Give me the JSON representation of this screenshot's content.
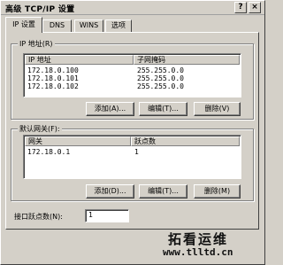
{
  "window": {
    "title": "高级 TCP/IP 设置",
    "help_button": "?",
    "close_button": "×"
  },
  "tabs": [
    {
      "label": "IP 设置"
    },
    {
      "label": "DNS"
    },
    {
      "label": "WINS"
    },
    {
      "label": "选项"
    }
  ],
  "ip_group": {
    "label": "IP 地址(R)",
    "columns": [
      "IP 地址",
      "子网掩码"
    ],
    "rows": [
      [
        "172.18.0.100",
        "255.255.0.0"
      ],
      [
        "172.18.0.101",
        "255.255.0.0"
      ],
      [
        "172.18.0.102",
        "255.255.0.0"
      ]
    ],
    "buttons": {
      "add": "添加(A)...",
      "edit": "编辑(T)...",
      "remove": "删除(V)"
    }
  },
  "gateway_group": {
    "label": "默认网关(F):",
    "columns": [
      "网关",
      "跃点数"
    ],
    "rows": [
      [
        "172.18.0.1",
        "1"
      ]
    ],
    "buttons": {
      "add": "添加(D)...",
      "edit": "编辑(T)...",
      "remove": "删除(M)"
    }
  },
  "interface_metric": {
    "label": "接口跃点数(N):",
    "value": "1"
  },
  "watermark": {
    "text": "拓看运维",
    "url": "www.tlltd.cn"
  }
}
